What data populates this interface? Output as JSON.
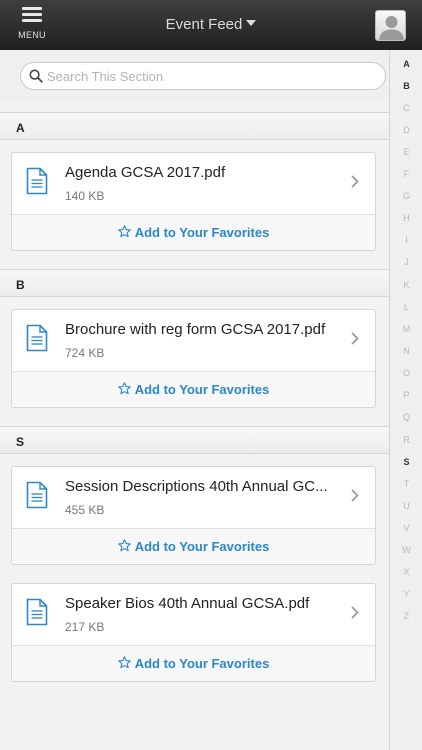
{
  "header": {
    "menu_label": "MENU",
    "title": "Event Feed"
  },
  "search": {
    "placeholder": "Search This Section"
  },
  "sections": [
    {
      "letter": "A",
      "items": [
        {
          "name": "Agenda GCSA 2017.pdf",
          "size": "140 KB",
          "favorite_label": "Add to Your Favorites"
        }
      ]
    },
    {
      "letter": "B",
      "items": [
        {
          "name": "Brochure with reg form GCSA 2017.pdf",
          "size": "724 KB",
          "favorite_label": "Add to Your Favorites"
        }
      ]
    },
    {
      "letter": "S",
      "items": [
        {
          "name": "Session Descriptions 40th Annual GC...",
          "size": "455 KB",
          "favorite_label": "Add to Your Favorites"
        },
        {
          "name": "Speaker Bios 40th Annual GCSA.pdf",
          "size": "217 KB",
          "favorite_label": "Add to Your Favorites"
        }
      ]
    }
  ],
  "index": {
    "letters": [
      "A",
      "B",
      "C",
      "D",
      "E",
      "F",
      "G",
      "H",
      "I",
      "J",
      "K",
      "L",
      "M",
      "N",
      "O",
      "P",
      "Q",
      "R",
      "S",
      "T",
      "U",
      "V",
      "W",
      "X",
      "Y",
      "Z"
    ],
    "active": [
      "A",
      "B",
      "S"
    ]
  },
  "colors": {
    "accent": "#2b87c6",
    "header_bg": "#2a2a2a"
  }
}
